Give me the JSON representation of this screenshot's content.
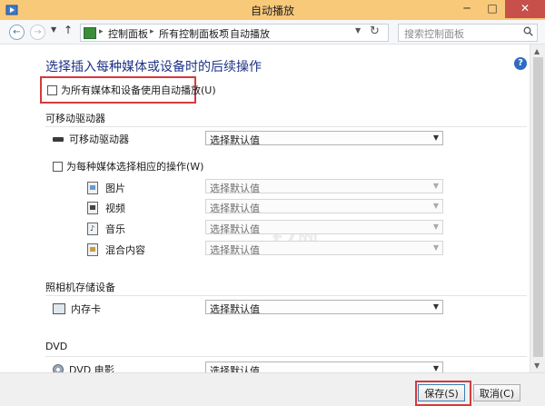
{
  "window": {
    "title": "自动播放",
    "minimize_label": "─",
    "maximize_label": "□",
    "close_label": "✕"
  },
  "address": {
    "breadcrumbs": [
      "控制面板",
      "所有控制面板项",
      "自动播放"
    ],
    "search_placeholder": "搜索控制面板"
  },
  "page": {
    "heading": "选择插入每种媒体或设备时的后续操作",
    "help_icon": "?",
    "autoplay_all_label": "为所有媒体和设备使用自动播放(U)",
    "autoplay_all_checked": false,
    "watermark": "t7网"
  },
  "removable": {
    "section_title": "可移动驱动器",
    "drive_label": "可移动驱动器",
    "drive_value": "选择默认值",
    "per_media_label": "为每种媒体选择相应的操作(W)",
    "per_media_checked": false,
    "media_items": [
      {
        "label": "图片",
        "value": "选择默认值",
        "icon": "picture-icon"
      },
      {
        "label": "视频",
        "value": "选择默认值",
        "icon": "video-icon"
      },
      {
        "label": "音乐",
        "value": "选择默认值",
        "icon": "music-icon"
      },
      {
        "label": "混合内容",
        "value": "选择默认值",
        "icon": "mixed-content-icon"
      }
    ]
  },
  "camera": {
    "section_title": "照相机存储设备",
    "card_label": "内存卡",
    "card_value": "选择默认值"
  },
  "dvd": {
    "section_title": "DVD",
    "movie_label": "DVD 电影",
    "movie_value": "选择默认值"
  },
  "footer": {
    "save_label": "保存(S)",
    "cancel_label": "取消(C)"
  },
  "colors": {
    "titlebar": "#f9c97a",
    "heading": "#1e3287",
    "highlight": "#d63a3a"
  }
}
